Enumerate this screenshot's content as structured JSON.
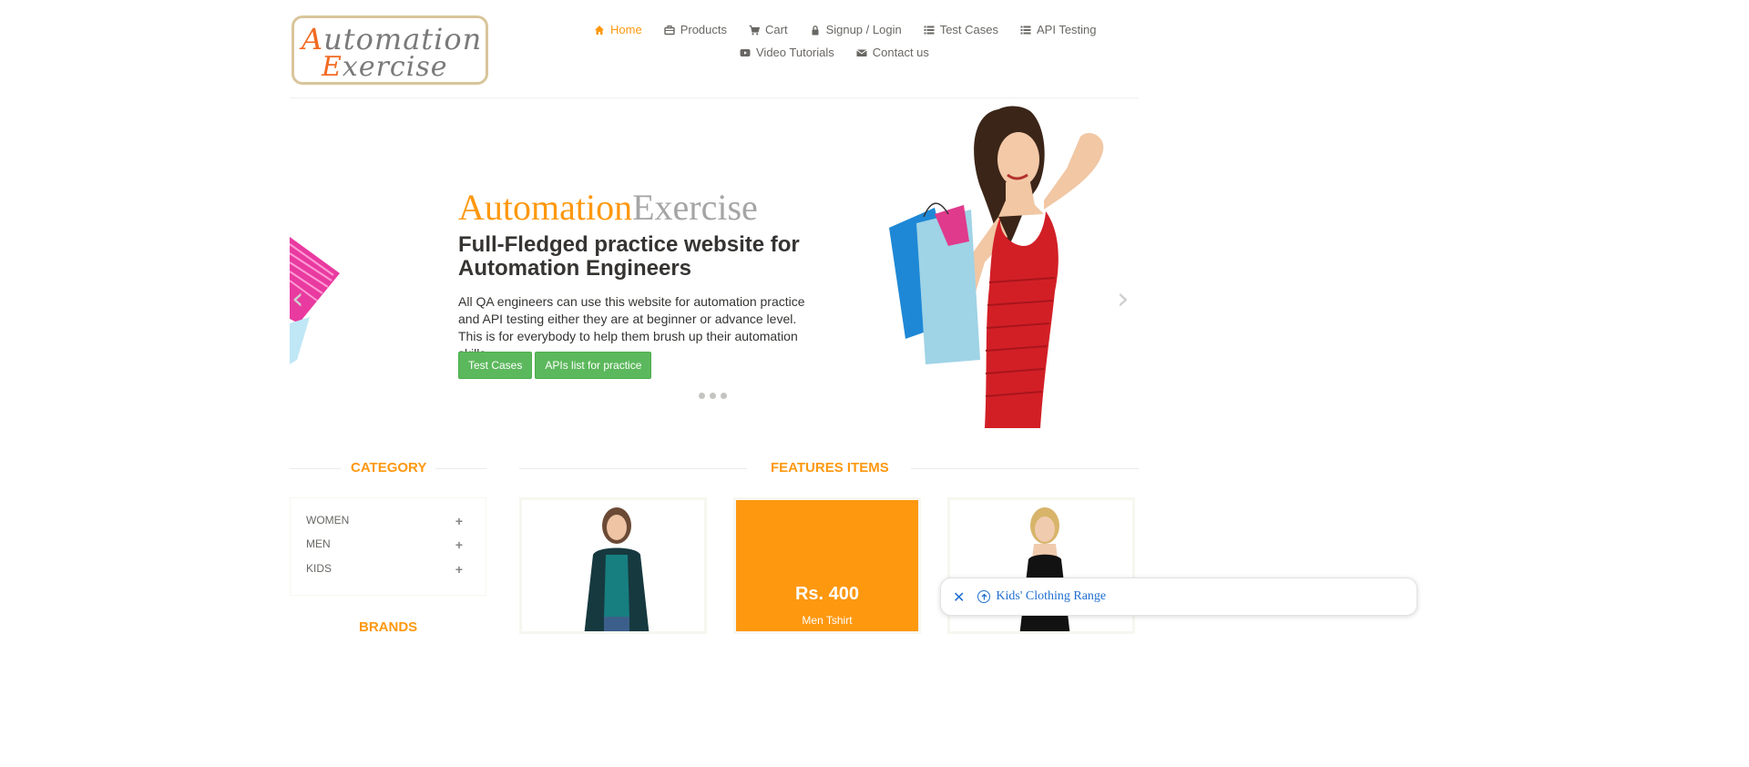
{
  "logo": {
    "line1": "Automation",
    "line2": "Exercise"
  },
  "nav": {
    "row1": [
      {
        "label": "Home",
        "icon": "home-icon",
        "active": true
      },
      {
        "label": "Products",
        "icon": "briefcase-icon"
      },
      {
        "label": "Cart",
        "icon": "cart-icon"
      },
      {
        "label": "Signup / Login",
        "icon": "lock-icon"
      },
      {
        "label": "Test Cases",
        "icon": "list-icon"
      },
      {
        "label": "API Testing",
        "icon": "list-icon"
      }
    ],
    "row2": [
      {
        "label": "Video Tutorials",
        "icon": "youtube-icon"
      },
      {
        "label": "Contact us",
        "icon": "envelope-icon"
      }
    ]
  },
  "hero": {
    "brand_part1": "Automation",
    "brand_part2": "Exercise",
    "title": "Full-Fledged practice website for Automation Engineers",
    "description": "All QA engineers can use this website for automation practice and API testing either they are at beginner or advance level. This is for everybody to help them brush up their automation skills.",
    "btn_test_cases": "Test Cases",
    "btn_apis": "APIs list for practice",
    "arrow_left": "‹",
    "arrow_right": "›"
  },
  "category": {
    "heading": "CATEGORY",
    "items": [
      "WOMEN",
      "MEN",
      "KIDS"
    ],
    "expand_symbol": "+"
  },
  "brands": {
    "heading": "BRANDS"
  },
  "features": {
    "heading": "FEATURES ITEMS",
    "featured_price": "Rs. 400",
    "featured_name": "Men Tshirt"
  },
  "toast": {
    "close": "✕",
    "label": "Kids' Clothing Range"
  },
  "colors": {
    "accent": "#fe980f",
    "green": "#5cb85c",
    "link": "#1f6fd0"
  }
}
